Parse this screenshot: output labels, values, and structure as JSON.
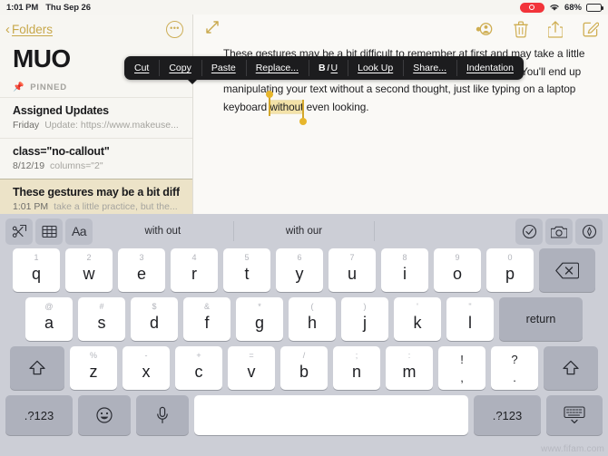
{
  "status_bar": {
    "time": "1:01 PM",
    "date": "Thu Sep 26",
    "recording_label": "recording-indicator",
    "wifi_label": "wifi-icon",
    "battery_percent": "68%",
    "battery_level": 68
  },
  "sidebar": {
    "back_label": "Folders",
    "more_label": "•••",
    "folder_title": "MUO",
    "pinned_label": "PINNED",
    "notes": [
      {
        "title": "Assigned Updates",
        "date": "Friday",
        "preview": "Update: https://www.makeuse...",
        "selected": false
      },
      {
        "title": "class=\"no-callout\"",
        "date": "8/12/19",
        "preview": "columns=\"2\"",
        "selected": false
      },
      {
        "title": "These gestures may be a bit diffi...",
        "date": "1:01 PM",
        "preview": "take a little practice, but the...",
        "selected": true
      }
    ]
  },
  "detail": {
    "expand_icon": "expand-diagonal-icon",
    "toolbar": [
      {
        "name": "add-person-button",
        "label": "Add People"
      },
      {
        "name": "delete-button",
        "label": "Delete"
      },
      {
        "name": "share-button",
        "label": "Share"
      },
      {
        "name": "compose-button",
        "label": "New Note"
      }
    ],
    "note_body": {
      "part1": "These gestures may be a bit difficult to remember at first and may take a little practice, but the more you use them, the easier they'll become. You'll end up manipulating your text without a second thought, just like typing on a laptop keyboard ",
      "selected_word": "without",
      "part2": " even looking."
    }
  },
  "context_menu": {
    "items": [
      {
        "name": "cut",
        "label": "Cut",
        "type": "text"
      },
      {
        "name": "copy",
        "label": "Copy",
        "type": "text"
      },
      {
        "name": "paste",
        "label": "Paste",
        "type": "text"
      },
      {
        "name": "replace",
        "label": "Replace...",
        "type": "text"
      },
      {
        "name": "format-biu",
        "label": "B I U",
        "type": "biu",
        "bold": "B",
        "italic": "I",
        "underline": "U"
      },
      {
        "name": "look-up",
        "label": "Look Up",
        "type": "text"
      },
      {
        "name": "share",
        "label": "Share...",
        "type": "text"
      },
      {
        "name": "indentation",
        "label": "Indentation",
        "type": "text"
      }
    ]
  },
  "keyboard": {
    "predictive_bar": {
      "left_tools": [
        {
          "name": "markup-scissors-icon",
          "label": "Markup"
        },
        {
          "name": "table-icon",
          "label": "Table"
        },
        {
          "name": "text-format-icon",
          "label": "Aa"
        }
      ],
      "predictions": [
        "with out",
        "with our",
        ""
      ],
      "right_tools": [
        {
          "name": "checklist-icon",
          "label": "Checklist"
        },
        {
          "name": "camera-icon",
          "label": "Camera"
        },
        {
          "name": "draw-icon",
          "label": "Draw"
        }
      ]
    },
    "row1": [
      {
        "main": "q",
        "alt": "1"
      },
      {
        "main": "w",
        "alt": "2"
      },
      {
        "main": "e",
        "alt": "3"
      },
      {
        "main": "r",
        "alt": "4"
      },
      {
        "main": "t",
        "alt": "5"
      },
      {
        "main": "y",
        "alt": "6"
      },
      {
        "main": "u",
        "alt": "7"
      },
      {
        "main": "i",
        "alt": "8"
      },
      {
        "main": "o",
        "alt": "9"
      },
      {
        "main": "p",
        "alt": "0"
      }
    ],
    "row2": [
      {
        "main": "a",
        "alt": "@"
      },
      {
        "main": "s",
        "alt": "#"
      },
      {
        "main": "d",
        "alt": "$"
      },
      {
        "main": "f",
        "alt": "&"
      },
      {
        "main": "g",
        "alt": "*"
      },
      {
        "main": "h",
        "alt": "("
      },
      {
        "main": "j",
        "alt": ")"
      },
      {
        "main": "k",
        "alt": "'"
      },
      {
        "main": "l",
        "alt": "\""
      }
    ],
    "row3": [
      {
        "main": "z",
        "alt": "%"
      },
      {
        "main": "x",
        "alt": "-"
      },
      {
        "main": "c",
        "alt": "+"
      },
      {
        "main": "v",
        "alt": "="
      },
      {
        "main": "b",
        "alt": "/"
      },
      {
        "main": "n",
        "alt": ";"
      },
      {
        "main": "m",
        "alt": ":"
      },
      {
        "main": ",",
        "alt": "!"
      },
      {
        "main": ".",
        "alt": "?"
      }
    ],
    "delete_label": "delete-key",
    "return_label": "return",
    "shift_label": "shift-key",
    "num_left_label": ".?123",
    "num_right_label": ".?123",
    "emoji_label": "emoji-key",
    "mic_label": "dictation-key",
    "space_label": "space-key",
    "dismiss_label": "dismiss-keyboard-key"
  },
  "watermark": "www.fifam.com",
  "colors": {
    "accent_gold": "#c8a84b",
    "selection_highlight": "#f3e2a8",
    "selected_row_bg": "#ece3c8",
    "keyboard_bg": "#ccced6",
    "context_menu_bg": "#1c1c1e"
  }
}
